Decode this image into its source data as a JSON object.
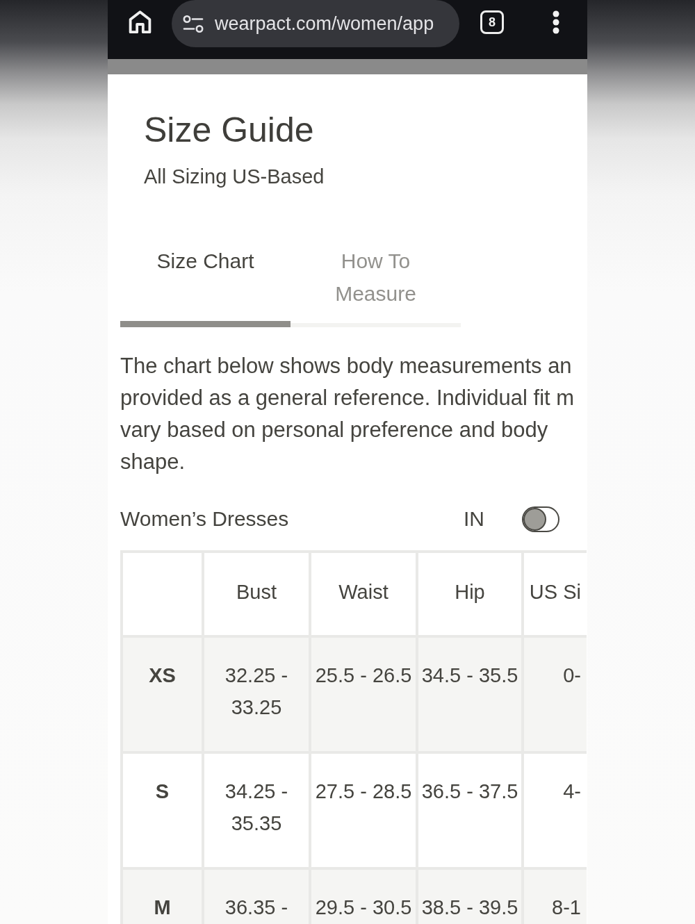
{
  "browser": {
    "url": "wearpact.com/women/app",
    "tab_count": "8"
  },
  "guide": {
    "title": "Size Guide",
    "subtitle": "All Sizing US-Based"
  },
  "tabs": [
    {
      "label": "Size Chart",
      "selected": true
    },
    {
      "label": "How To Measure",
      "selected": false
    }
  ],
  "intro": {
    "lines": [
      "The chart below shows body measurements an",
      "provided as a general reference. Individual fit m",
      "vary based on personal preference and body",
      "shape."
    ]
  },
  "chart_header": {
    "category": "Women’s Dresses",
    "unit": "IN",
    "toggle": {
      "on": false
    }
  },
  "table": {
    "columns": [
      "Bust",
      "Waist",
      "Hip",
      "US Si"
    ],
    "rows": [
      {
        "size": "XS",
        "cells": [
          "32.25 - 33.25",
          "25.5 - 26.5",
          "34.5 - 35.5",
          "0-"
        ]
      },
      {
        "size": "S",
        "cells": [
          "34.25 - 35.35",
          "27.5 - 28.5",
          "36.5 - 37.5",
          "4-"
        ]
      },
      {
        "size": "M",
        "cells": [
          "36.35 -",
          "29.5 - 30.5",
          "38.5 - 39.5",
          "8-1"
        ]
      }
    ]
  }
}
